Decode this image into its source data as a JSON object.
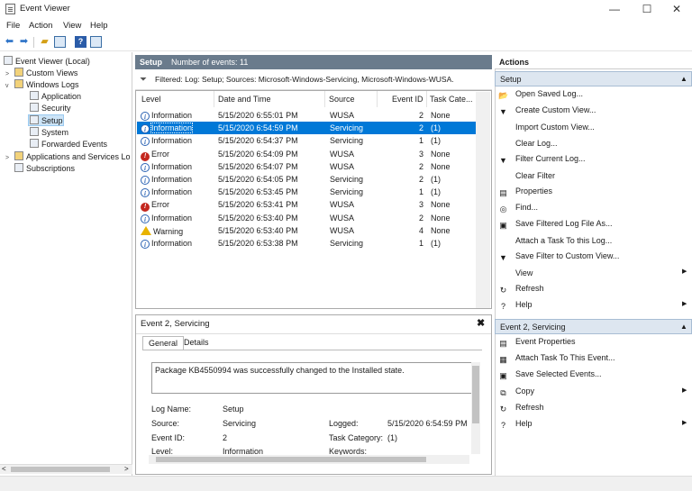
{
  "window": {
    "title": "Event Viewer",
    "min": "—",
    "max": "☐",
    "close": "✕"
  },
  "menu": [
    "File",
    "Action",
    "View",
    "Help"
  ],
  "tree": {
    "root": "Event Viewer (Local)",
    "custom_views": "Custom Views",
    "windows_logs": "Windows Logs",
    "application": "Application",
    "security": "Security",
    "setup": "Setup",
    "system": "System",
    "forwarded": "Forwarded Events",
    "apps_services": "Applications and Services Lo",
    "subscriptions": "Subscriptions"
  },
  "middle": {
    "log_name": "Setup",
    "events_count": "Number of events: 11",
    "filter_text": "Filtered: Log: Setup; Sources: Microsoft-Windows-Servicing, Microsoft-Windows-WUSA.",
    "columns": [
      "Level",
      "Date and Time",
      "Source",
      "Event ID",
      "Task Cate..."
    ],
    "rows": [
      {
        "level": "Information",
        "icon": "info",
        "date": "5/15/2020 6:55:01 PM",
        "source": "WUSA",
        "id": "2",
        "task": "None"
      },
      {
        "level": "Information",
        "icon": "info",
        "date": "5/15/2020 6:54:59 PM",
        "source": "Servicing",
        "id": "2",
        "task": "(1)"
      },
      {
        "level": "Information",
        "icon": "info",
        "date": "5/15/2020 6:54:37 PM",
        "source": "Servicing",
        "id": "1",
        "task": "(1)"
      },
      {
        "level": "Error",
        "icon": "err",
        "date": "5/15/2020 6:54:09 PM",
        "source": "WUSA",
        "id": "3",
        "task": "None"
      },
      {
        "level": "Information",
        "icon": "info",
        "date": "5/15/2020 6:54:07 PM",
        "source": "WUSA",
        "id": "2",
        "task": "None"
      },
      {
        "level": "Information",
        "icon": "info",
        "date": "5/15/2020 6:54:05 PM",
        "source": "Servicing",
        "id": "2",
        "task": "(1)"
      },
      {
        "level": "Information",
        "icon": "info",
        "date": "5/15/2020 6:53:45 PM",
        "source": "Servicing",
        "id": "1",
        "task": "(1)"
      },
      {
        "level": "Error",
        "icon": "err",
        "date": "5/15/2020 6:53:41 PM",
        "source": "WUSA",
        "id": "3",
        "task": "None"
      },
      {
        "level": "Information",
        "icon": "info",
        "date": "5/15/2020 6:53:40 PM",
        "source": "WUSA",
        "id": "2",
        "task": "None"
      },
      {
        "level": "Warning",
        "icon": "warn",
        "date": "5/15/2020 6:53:40 PM",
        "source": "WUSA",
        "id": "4",
        "task": "None"
      },
      {
        "level": "Information",
        "icon": "info",
        "date": "5/15/2020 6:53:38 PM",
        "source": "Servicing",
        "id": "1",
        "task": "(1)"
      }
    ]
  },
  "detail": {
    "title": "Event 2, Servicing",
    "close": "✖",
    "tabs": [
      "General",
      "Details"
    ],
    "message": "Package KB4550994 was successfully changed to the Installed state.",
    "log_name_label": "Log Name:",
    "log_name_value": "Setup",
    "source_label": "Source:",
    "source_value": "Servicing",
    "logged_label": "Logged:",
    "logged_value": "5/15/2020 6:54:59 PM",
    "event_id_label": "Event ID:",
    "event_id_value": "2",
    "task_label": "Task Category:",
    "task_value": "(1)",
    "level_label": "Level:",
    "level_value": "Information",
    "keywords_label": "Keywords:"
  },
  "actions": {
    "header": "Actions",
    "section1": "Setup",
    "items1": [
      {
        "label": "Open Saved Log...",
        "icon": "folder-icon",
        "glyph": "📂",
        "sub": false
      },
      {
        "label": "Create Custom View...",
        "icon": "filter-icon",
        "glyph": "▼",
        "sub": false
      },
      {
        "label": "Import Custom View...",
        "icon": "",
        "glyph": "",
        "sub": false
      },
      {
        "label": "Clear Log...",
        "icon": "",
        "glyph": "",
        "sub": false
      },
      {
        "label": "Filter Current Log...",
        "icon": "filter-icon",
        "glyph": "▼",
        "sub": false
      },
      {
        "label": "Clear Filter",
        "icon": "",
        "glyph": "",
        "sub": false
      },
      {
        "label": "Properties",
        "icon": "properties-icon",
        "glyph": "▤",
        "sub": false
      },
      {
        "label": "Find...",
        "icon": "binoculars-icon",
        "glyph": "◎",
        "sub": false
      },
      {
        "label": "Save Filtered Log File As...",
        "icon": "save-icon",
        "glyph": "▣",
        "sub": false
      },
      {
        "label": "Attach a Task To this Log...",
        "icon": "",
        "glyph": "",
        "sub": false
      },
      {
        "label": "Save Filter to Custom View...",
        "icon": "filter-save-icon",
        "glyph": "▼",
        "sub": false
      },
      {
        "label": "View",
        "icon": "",
        "glyph": "",
        "sub": true
      },
      {
        "label": "Refresh",
        "icon": "refresh-icon",
        "glyph": "↻",
        "sub": false
      },
      {
        "label": "Help",
        "icon": "help-icon",
        "glyph": "?",
        "sub": true
      }
    ],
    "section2": "Event 2, Servicing",
    "items2": [
      {
        "label": "Event Properties",
        "icon": "properties-icon",
        "glyph": "▤",
        "sub": false
      },
      {
        "label": "Attach Task To This Event...",
        "icon": "task-icon",
        "glyph": "▦",
        "sub": false
      },
      {
        "label": "Save Selected Events...",
        "icon": "save-icon",
        "glyph": "▣",
        "sub": false
      },
      {
        "label": "Copy",
        "icon": "copy-icon",
        "glyph": "⧉",
        "sub": true
      },
      {
        "label": "Refresh",
        "icon": "refresh-icon",
        "glyph": "↻",
        "sub": false
      },
      {
        "label": "Help",
        "icon": "help-icon",
        "glyph": "?",
        "sub": true
      }
    ]
  },
  "colors": {
    "selection": "#0078d7",
    "header": "#6a7b8c",
    "section": "#dde6f0"
  }
}
